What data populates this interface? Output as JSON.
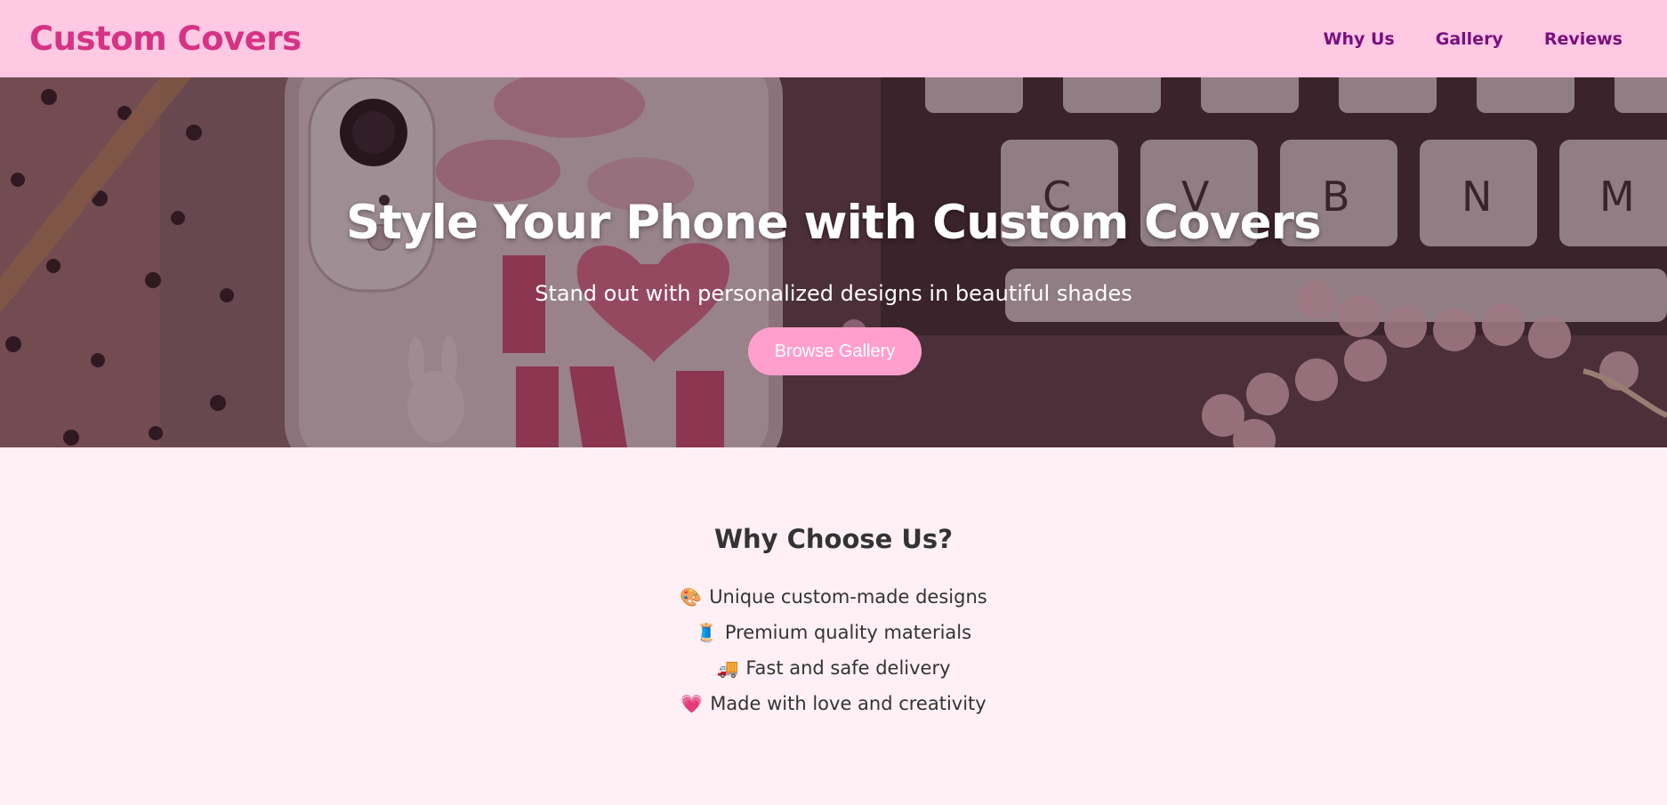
{
  "header": {
    "brand": "Custom Covers",
    "nav": [
      {
        "label": "Why Us"
      },
      {
        "label": "Gallery"
      },
      {
        "label": "Reviews"
      }
    ]
  },
  "hero": {
    "title": "Style Your Phone with Custom Covers",
    "subtitle": "Stand out with personalized designs in beautiful shades",
    "button_label": "Browse Gallery"
  },
  "why": {
    "title": "Why Choose Us?",
    "items": [
      {
        "icon": "palette-icon",
        "glyph": "🎨",
        "text": "Unique custom-made designs"
      },
      {
        "icon": "thread-spool-icon",
        "glyph": "🧵",
        "text": "Premium quality materials"
      },
      {
        "icon": "delivery-truck-icon",
        "glyph": "🚚",
        "text": "Fast and safe delivery"
      },
      {
        "icon": "heart-icon",
        "glyph": "💗",
        "text": "Made with love and creativity"
      }
    ]
  },
  "colors": {
    "header_bg": "#ffc8e3",
    "brand": "#d63384",
    "nav": "#7a0f7c",
    "button": "#ff9fcd",
    "section_bg": "#fff0f5"
  }
}
